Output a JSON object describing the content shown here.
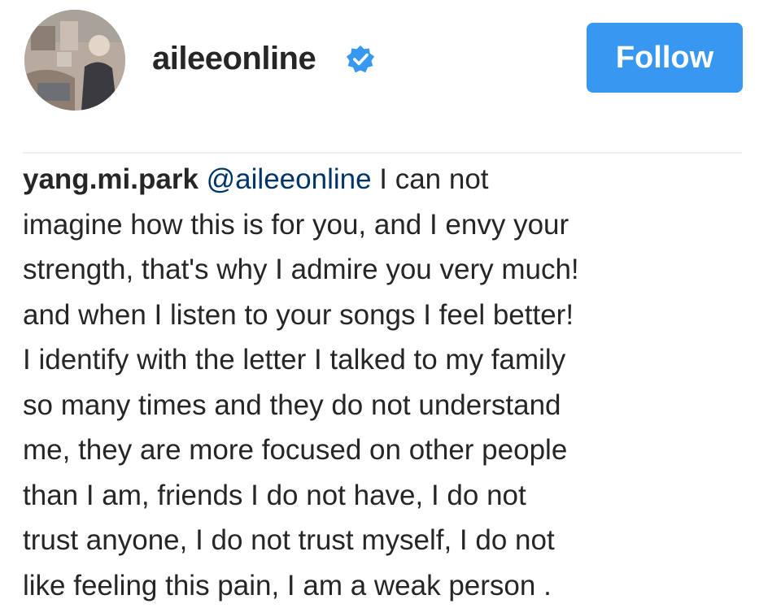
{
  "header": {
    "username": "aileeonline",
    "verified": true,
    "follow_label": "Follow",
    "accent_color": "#3897f0",
    "verified_icon": "verified-badge-icon"
  },
  "comment": {
    "author": "yang.mi.park",
    "mention": "@aileeonline",
    "first_line_rest": " I can not",
    "lines": [
      "imagine how this is for you, and I envy your",
      "strength, that's why I admire you very much!",
      "and when I listen to your songs I feel better!",
      "I identify with the letter I talked to my family",
      "so many times and they do not understand",
      "me, they are more focused on other people",
      "than I am, friends I do not have, I do not",
      "trust anyone, I do not trust myself, I do not",
      "like feeling this pain, I am a weak person ."
    ]
  }
}
